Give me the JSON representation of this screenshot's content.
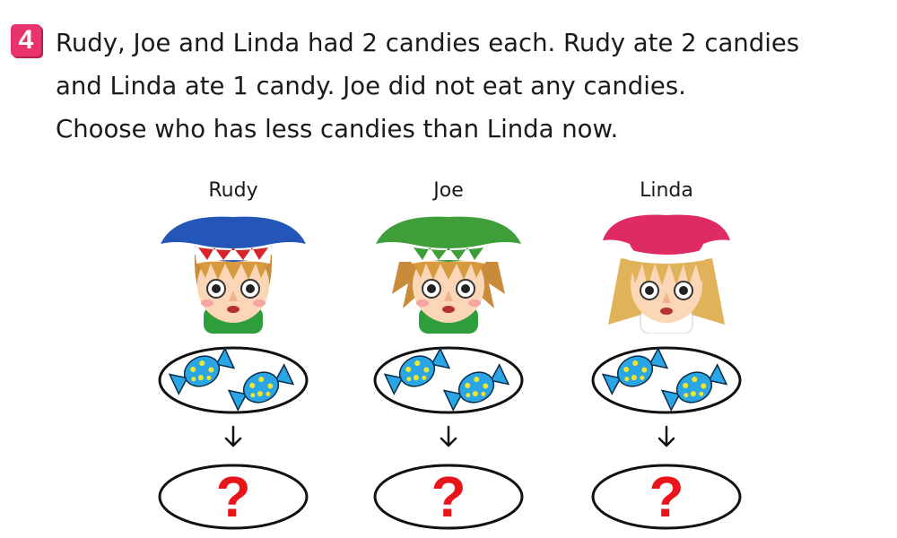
{
  "question": {
    "number": "4",
    "lines": [
      "Rudy, Joe and Linda had 2 candies each. Rudy ate 2 candies",
      "and Linda ate 1 candy. Joe did not eat any candies.",
      "Choose who has less candies than Linda now."
    ]
  },
  "characters": [
    {
      "name": "Rudy",
      "hat_color": "#2456b8",
      "shirt_color": "#2e9e3a",
      "candies_shown": 2,
      "answer_symbol": "?"
    },
    {
      "name": "Joe",
      "hat_color": "#3e9e3a",
      "shirt_color": "#2e9e3a",
      "candies_shown": 2,
      "answer_symbol": "?"
    },
    {
      "name": "Linda",
      "hat_color": "#e02a62",
      "shirt_color": "#ffffff",
      "candies_shown": 2,
      "answer_symbol": "?"
    }
  ],
  "colors": {
    "question_badge": "#e8336d",
    "candy": "#2aa6e6",
    "candy_dots": "#f5e52a",
    "question_mark": "#e8151b"
  }
}
